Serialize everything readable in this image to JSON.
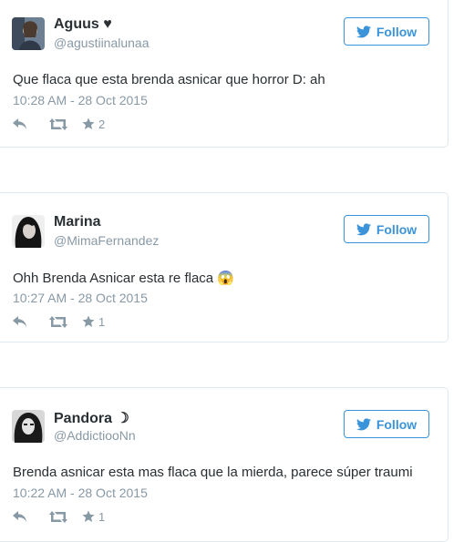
{
  "follow_label": "Follow",
  "colors": {
    "link": "#3b94d9",
    "text": "#292f33",
    "muted": "#8899a6",
    "border": "#e1e8ed"
  },
  "tweets": [
    {
      "name": "Aguus ♥",
      "handle": "@agustiinalunaa",
      "text": "Que flaca que esta brenda asnicar que horror D: ah",
      "time": "10:28 AM - 28 Oct 2015",
      "favorites": "2",
      "icons": [
        "reply-icon",
        "retweet-icon",
        "star-icon"
      ]
    },
    {
      "name": "Marina",
      "handle": "@MimaFernandez",
      "text": "Ohh Brenda Asnicar esta re flaca 😱",
      "time": "10:27 AM - 28 Oct 2015",
      "favorites": "1",
      "icons": [
        "reply-icon",
        "retweet-icon",
        "star-icon"
      ]
    },
    {
      "name": "Pandora ☽",
      "handle": "@AddictiooNn",
      "text": "Brenda asnicar esta mas flaca que la mierda, parece súper traumi",
      "time": "10:22 AM - 28 Oct 2015",
      "favorites": "1",
      "icons": [
        "reply-icon",
        "retweet-icon",
        "star-icon"
      ]
    }
  ]
}
